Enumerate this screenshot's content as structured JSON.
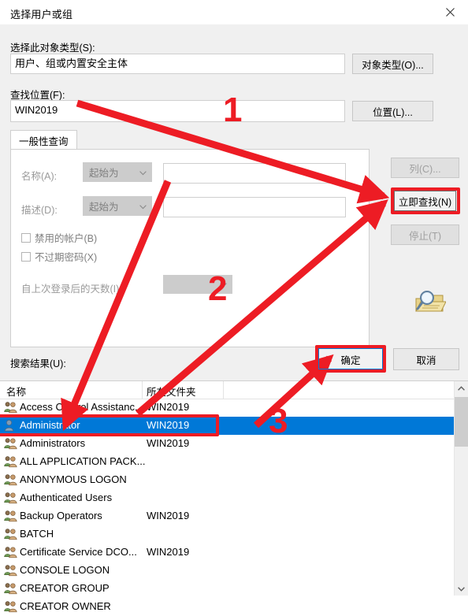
{
  "window": {
    "title": "选择用户或组",
    "close_icon": "close-icon"
  },
  "object_type": {
    "label": "选择此对象类型(S):",
    "value": "用户、组或内置安全主体",
    "button": "对象类型(O)..."
  },
  "location": {
    "label": "查找位置(F):",
    "value": "WIN2019",
    "button": "位置(L)..."
  },
  "tab": {
    "label": "一般性查询"
  },
  "query": {
    "name_label": "名称(A):",
    "name_op": "起始为",
    "name_value": "",
    "desc_label": "描述(D):",
    "desc_op": "起始为",
    "desc_value": "",
    "disabled_accounts": "禁用的帐户(B)",
    "non_expiring_password": "不过期密码(X)",
    "days_since_logon_label": "自上次登录后的天数(I):",
    "days_since_logon_value": ""
  },
  "side_buttons": {
    "columns": "列(C)...",
    "find_now": "立即查找(N)",
    "stop": "停止(T)",
    "search_icon": "magnifier-folder-icon"
  },
  "dialog_buttons": {
    "ok": "确定",
    "cancel": "取消"
  },
  "results": {
    "label": "搜索结果(U):",
    "columns": [
      "名称",
      "所在文件夹"
    ],
    "rows": [
      {
        "name": "Access Control Assistanc...",
        "folder": "WIN2019",
        "icon": "user-group-icon",
        "selected": false
      },
      {
        "name": "Administrator",
        "folder": "WIN2019",
        "icon": "user-icon",
        "selected": true
      },
      {
        "name": "Administrators",
        "folder": "WIN2019",
        "icon": "user-group-icon",
        "selected": false
      },
      {
        "name": "ALL APPLICATION PACK...",
        "folder": "",
        "icon": "user-group-icon",
        "selected": false
      },
      {
        "name": "ANONYMOUS LOGON",
        "folder": "",
        "icon": "user-group-icon",
        "selected": false
      },
      {
        "name": "Authenticated Users",
        "folder": "",
        "icon": "user-group-icon",
        "selected": false
      },
      {
        "name": "Backup Operators",
        "folder": "WIN2019",
        "icon": "user-group-icon",
        "selected": false
      },
      {
        "name": "BATCH",
        "folder": "",
        "icon": "user-group-icon",
        "selected": false
      },
      {
        "name": "Certificate Service DCO...",
        "folder": "WIN2019",
        "icon": "user-group-icon",
        "selected": false
      },
      {
        "name": "CONSOLE LOGON",
        "folder": "",
        "icon": "user-group-icon",
        "selected": false
      },
      {
        "name": "CREATOR GROUP",
        "folder": "",
        "icon": "user-group-icon",
        "selected": false
      },
      {
        "name": "CREATOR OWNER",
        "folder": "",
        "icon": "user-group-icon",
        "selected": false
      }
    ]
  },
  "annotations": {
    "accent_color": "#ed1c24",
    "step1": "1",
    "step2": "2",
    "step3": "3"
  }
}
